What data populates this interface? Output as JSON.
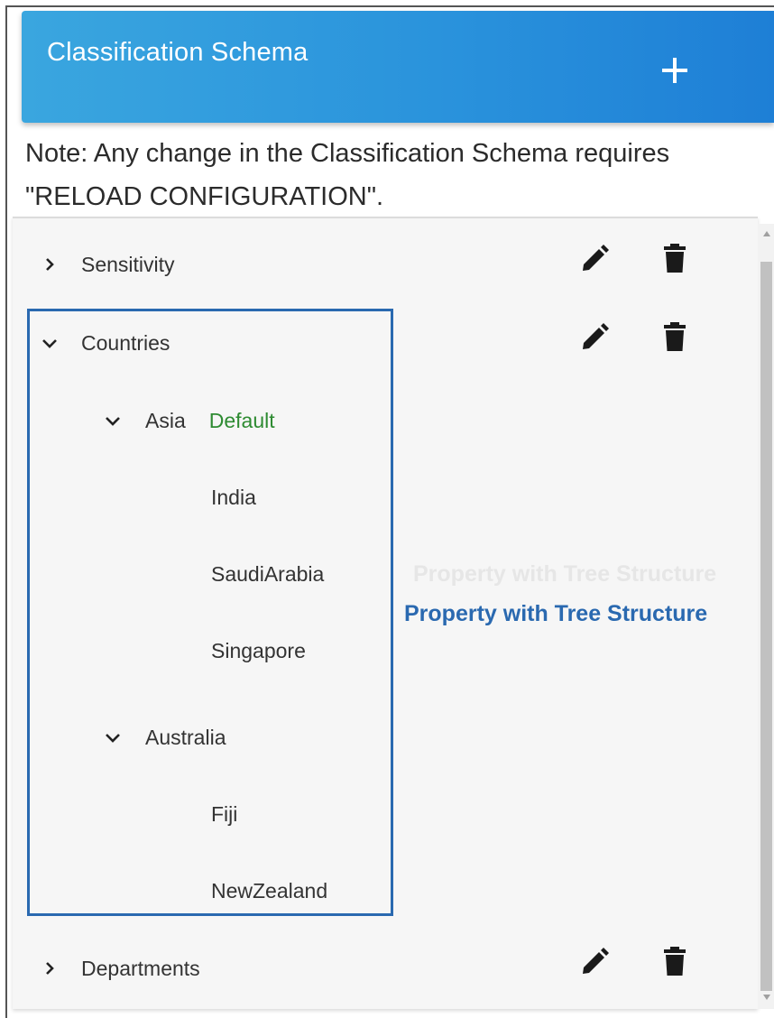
{
  "header": {
    "title": "Classification Schema",
    "add_label": "+"
  },
  "note": "Note: Any change in the Classification Schema requires \"RELOAD CONFIGURATION\".",
  "tree": {
    "sensitivity": {
      "label": "Sensitivity",
      "expanded": false
    },
    "countries": {
      "label": "Countries",
      "expanded": true,
      "asia": {
        "label": "Asia",
        "tag": "Default",
        "children": [
          "India",
          "SaudiArabia",
          "Singapore"
        ]
      },
      "australia": {
        "label": "Australia",
        "children": [
          "Fiji",
          "NewZealand"
        ]
      }
    },
    "departments": {
      "label": "Departments",
      "expanded": false
    }
  },
  "callout": "Property with Tree Structure",
  "colors": {
    "header_start": "#3aa6df",
    "header_end": "#1e7fd6",
    "highlight": "#2a69b0",
    "default_tag": "#2e8b32"
  },
  "icons": [
    "plus-icon",
    "chevron-right-icon",
    "chevron-down-icon",
    "pencil-icon",
    "trash-icon"
  ]
}
